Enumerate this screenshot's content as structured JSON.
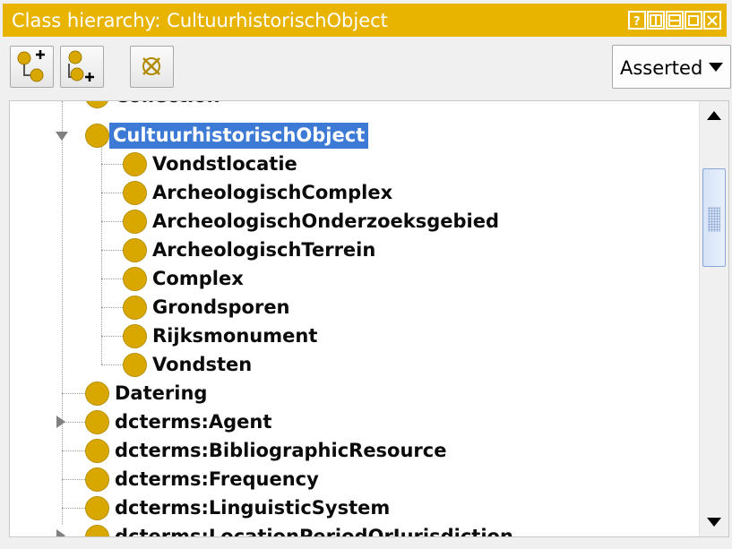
{
  "window": {
    "title": "Class hierarchy: CultuurhistorischObject",
    "buttons": [
      "help-icon",
      "split-vertical-icon",
      "split-horizontal-icon",
      "maximize-icon",
      "close-icon"
    ]
  },
  "toolbar": {
    "add_subclass_icon": "add-subclass-icon",
    "add_sibling_icon": "add-sibling-icon",
    "delete_class_icon": "delete-class-icon",
    "mode_select": "Asserted"
  },
  "tree": {
    "partial_top": "Collection",
    "selected": "CultuurhistorischObject",
    "children": [
      "Vondstlocatie",
      "ArcheologischComplex",
      "ArcheologischOnderzoeksgebied",
      "ArcheologischTerrein",
      "Complex",
      "Grondsporen",
      "Rijksmonument",
      "Vondsten"
    ],
    "siblings": [
      "Datering",
      "dcterms:Agent",
      "dcterms:BibliographicResource",
      "dcterms:Frequency",
      "dcterms:LinguisticSystem"
    ],
    "partial_bottom": "dcterms:LocationPeriodOrJurisdiction"
  },
  "colors": {
    "title_bar": "#e8b400",
    "class_dot": "#d9a800",
    "selection": "#3d7ad6"
  }
}
